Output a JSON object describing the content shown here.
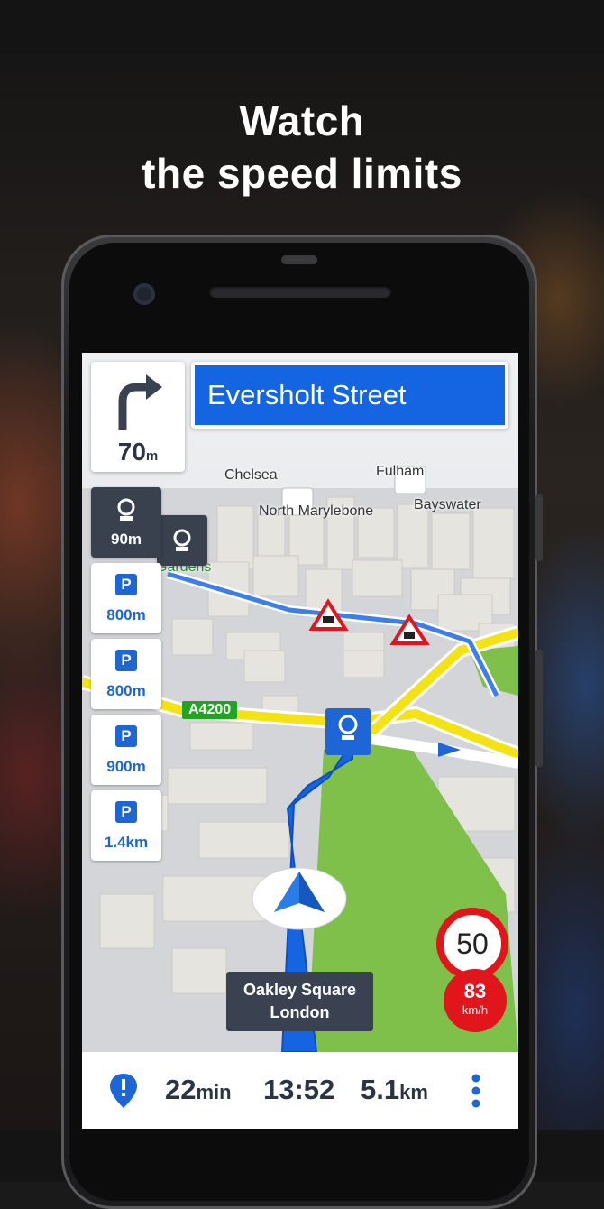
{
  "headline": {
    "line1": "Watch",
    "line2": "the speed limits"
  },
  "navigation": {
    "turn_distance_value": "70",
    "turn_distance_unit": "m",
    "street_name": "Eversholt Street"
  },
  "map": {
    "labels": [
      "Chelsea",
      "Fulham",
      "North Marylebone",
      "Bayswater",
      "Gardens"
    ],
    "road_label": "A4200"
  },
  "poi_list": [
    {
      "type": "speed-camera",
      "distance": "90m"
    },
    {
      "type": "parking",
      "distance": "800m"
    },
    {
      "type": "parking-covered",
      "distance": "800m"
    },
    {
      "type": "parking",
      "distance": "900m"
    },
    {
      "type": "parking",
      "distance": "1.4km"
    }
  ],
  "speed": {
    "limit": "50",
    "current": "83",
    "unit": "km/h"
  },
  "destination": {
    "line1": "Oakley Square",
    "line2": "London"
  },
  "route_info": {
    "duration_value": "22",
    "duration_unit": "min",
    "arrival_time": "13:52",
    "distance_value": "5.1",
    "distance_unit": "km"
  },
  "colors": {
    "route_blue": "#1565e3",
    "speed_red": "#e0161c",
    "road_yellow": "#f3e316",
    "park_green": "#7ec04a"
  }
}
